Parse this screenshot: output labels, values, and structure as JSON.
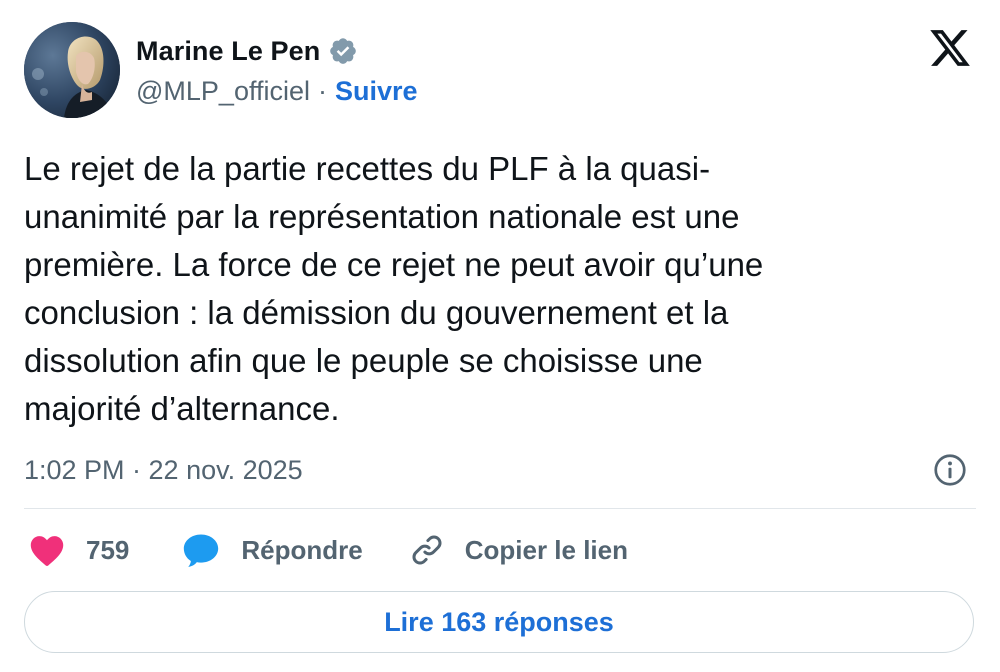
{
  "author": {
    "name": "Marine Le Pen",
    "handle": "@MLP_officiel",
    "separator": "·",
    "follow_label": "Suivre",
    "verified_icon": "verified-badge-icon",
    "avatar": "profile-photo"
  },
  "brand_icon": "x-logo-icon",
  "tweet": {
    "text": "Le rejet de la partie recettes du PLF à la quasi-\nunanimité par la représentation nationale est une\npremière. La force de ce rejet ne peut avoir qu’une\nconclusion : la démission du gouvernement et la\ndissolution afin que le peuple se choisisse une\nmajorité d’alternance.",
    "timestamp": "1:02 PM · 22 nov. 2025"
  },
  "actions": {
    "like_count": "759",
    "reply_label": "Répondre",
    "copy_link_label": "Copier le lien"
  },
  "read_replies_label": "Lire 163 réponses",
  "colors": {
    "accent": "#1d6fd6",
    "like": "#f0307a",
    "reply_bubble": "#1d9bf0",
    "muted_text": "#536471",
    "badge": "#829aab"
  }
}
